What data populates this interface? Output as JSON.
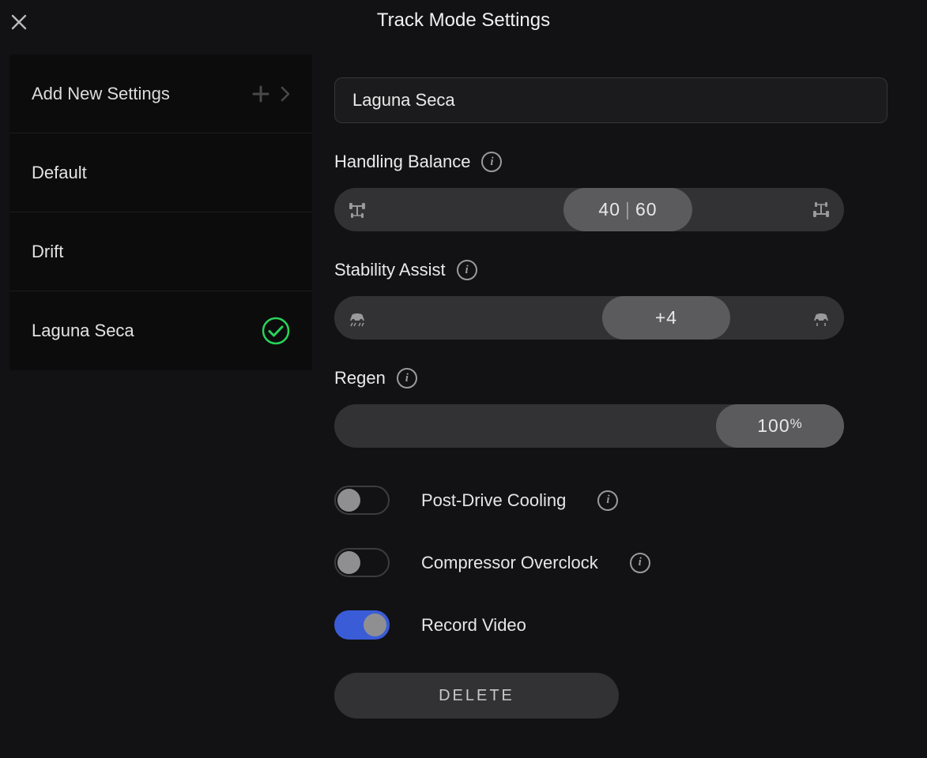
{
  "title": "Track Mode Settings",
  "sidebar": {
    "add_label": "Add New Settings",
    "items": [
      {
        "label": "Default",
        "selected": false
      },
      {
        "label": "Drift",
        "selected": false
      },
      {
        "label": "Laguna Seca",
        "selected": true
      }
    ]
  },
  "profile_name": "Laguna Seca",
  "handling": {
    "label": "Handling Balance",
    "front": "40",
    "rear": "60"
  },
  "stability": {
    "label": "Stability Assist",
    "value": "+4"
  },
  "regen": {
    "label": "Regen",
    "value": "100",
    "unit": "%"
  },
  "toggles": {
    "post_drive_cooling": {
      "label": "Post-Drive Cooling",
      "on": false
    },
    "compressor_overclock": {
      "label": "Compressor Overclock",
      "on": false
    },
    "record_video": {
      "label": "Record Video",
      "on": true
    }
  },
  "delete_label": "DELETE"
}
